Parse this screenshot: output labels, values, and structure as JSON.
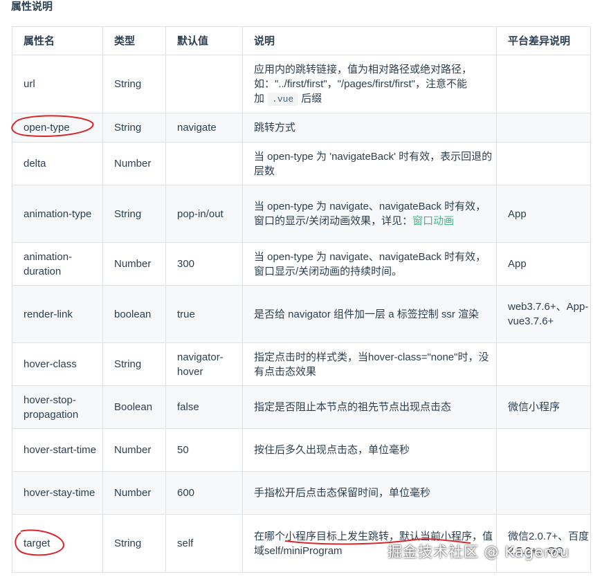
{
  "section_title": "属性说明",
  "table": {
    "headers": [
      "属性名",
      "类型",
      "默认值",
      "说明",
      "平台差异说明"
    ],
    "rows": [
      {
        "name": "url",
        "type": "String",
        "default": "",
        "desc_pre": "应用内的跳转链接，值为相对路径或绝对路径，如：\"../first/first\"，\"/pages/first/first\"，注意不能加",
        "desc_code": ".vue",
        "desc_post": "后缀",
        "platform": ""
      },
      {
        "name": "open-type",
        "type": "String",
        "default": "navigate",
        "desc": "跳转方式",
        "platform": ""
      },
      {
        "name": "delta",
        "type": "Number",
        "default": "",
        "desc": "当 open-type 为 'navigateBack' 时有效，表示回退的层数",
        "platform": ""
      },
      {
        "name": "animation-type",
        "type": "String",
        "default": "pop-in/out",
        "desc_pre": "当 open-type 为 navigate、navigateBack 时有效，窗口的显示/关闭动画效果，详见：",
        "desc_link": "窗口动画",
        "platform": "App"
      },
      {
        "name": "animation-duration",
        "type": "Number",
        "default": "300",
        "desc": "当 open-type 为 navigate、navigateBack 时有效，窗口显示/关闭动画的持续时间。",
        "platform": "App"
      },
      {
        "name": "render-link",
        "type": "boolean",
        "default": "true",
        "desc": "是否给 navigator 组件加一层 a 标签控制 ssr 渲染",
        "platform": "web3.7.6+、App-vue3.7.6+"
      },
      {
        "name": "hover-class",
        "type": "String",
        "default": "navigator-hover",
        "desc": "指定点击时的样式类，当hover-class=\"none\"时，没有点击态效果",
        "platform": ""
      },
      {
        "name": "hover-stop-propagation",
        "type": "Boolean",
        "default": "false",
        "desc": "指定是否阻止本节点的祖先节点出现点击态",
        "platform": "微信小程序"
      },
      {
        "name": "hover-start-time",
        "type": "Number",
        "default": "50",
        "desc": "按住后多久出现点击态，单位毫秒",
        "platform": ""
      },
      {
        "name": "hover-stay-time",
        "type": "Number",
        "default": "600",
        "desc": "手指松开后点击态保留时间，单位毫秒",
        "platform": ""
      },
      {
        "name": "target",
        "type": "String",
        "default": "self",
        "desc": "在哪个小程序目标上发生跳转，默认当前小程序，值域self/miniProgram",
        "platform": "微信2.0.7+、百度2.5.2+、QQ"
      }
    ]
  },
  "watermark": "掘金技术社区 @ Kagerou",
  "colors": {
    "annotation_red": "#d9262b",
    "link_green": "#42b983",
    "border": "#dfe2e5",
    "stripe": "#f6f8fa"
  }
}
